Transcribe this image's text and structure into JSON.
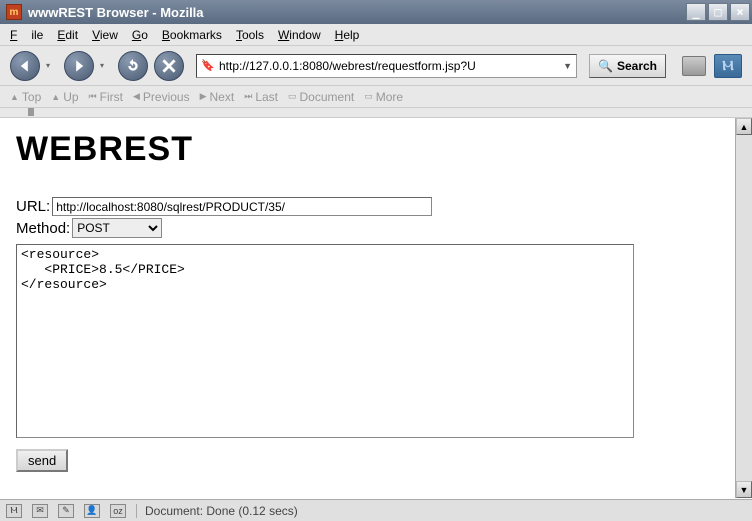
{
  "window": {
    "title": "wwwREST Browser - Mozilla"
  },
  "menu": {
    "file": "File",
    "edit": "Edit",
    "view": "View",
    "go": "Go",
    "bookmarks": "Bookmarks",
    "tools": "Tools",
    "window": "Window",
    "help": "Help"
  },
  "addressbar": {
    "url": "http://127.0.0.1:8080/webrest/requestform.jsp?U",
    "search_label": "Search"
  },
  "nav2": {
    "top": "Top",
    "up": "Up",
    "first": "First",
    "previous": "Previous",
    "next": "Next",
    "last": "Last",
    "document": "Document",
    "more": "More"
  },
  "page": {
    "heading": "WEBREST",
    "url_label": "URL:",
    "url_value": "http://localhost:8080/sqlrest/PRODUCT/35/",
    "method_label": "Method:",
    "method_value": "POST",
    "body": "<resource>\n   <PRICE>8.5</PRICE>\n</resource>",
    "send_label": "send"
  },
  "status": {
    "text": "Document: Done (0.12 secs)"
  }
}
